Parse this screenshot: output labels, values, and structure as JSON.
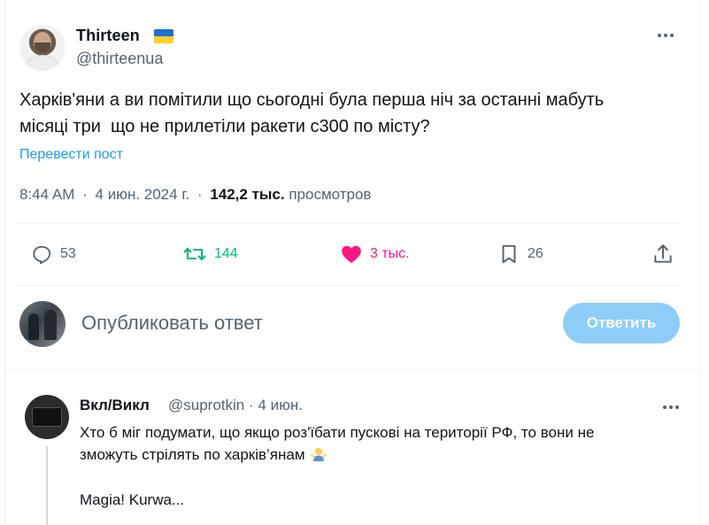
{
  "tweet": {
    "author": {
      "display_name": "Thirteen",
      "flag_icon": "ukraine-flag-icon",
      "handle": "@thirteenua"
    },
    "text": "Харків'яни а ви помітили що сьогодні була перша ніч за останні мабуть\nмісяці три  що не прилетіли ракети с300 по місту?",
    "translate_label": "Перевести пост",
    "time": "8:44 AM",
    "date": "4 июн. 2024 г.",
    "views_count": "142,2 тыс.",
    "views_label": "просмотров",
    "separator": "·"
  },
  "actions": {
    "replies": {
      "icon": "reply-icon",
      "count": "53"
    },
    "retweets": {
      "icon": "retweet-icon",
      "count": "144"
    },
    "likes": {
      "icon": "heart-icon",
      "count": "3 тыс."
    },
    "bookmarks": {
      "icon": "bookmark-icon",
      "count": "26"
    },
    "share": {
      "icon": "share-icon"
    }
  },
  "reply_composer": {
    "placeholder": "Опубликовать ответ",
    "button_label": "Ответить"
  },
  "comment": {
    "display_name": "Вкл/Викл",
    "handle": "@suprotkin",
    "separator": "·",
    "date": "4 июн.",
    "text": "Хто б міг подумати, що якщо роз'їбати пускові на території РФ, то вони не\nзможуть стрілять по харків’янам",
    "emoji_icon": "man-shrugging-icon",
    "text2": "Magia! Kurwa..."
  },
  "colors": {
    "accent": "#1d9bf0",
    "retweet": "#00ba7c",
    "like": "#f91880",
    "reply_button": "#8ecdf8",
    "muted": "#536471"
  }
}
